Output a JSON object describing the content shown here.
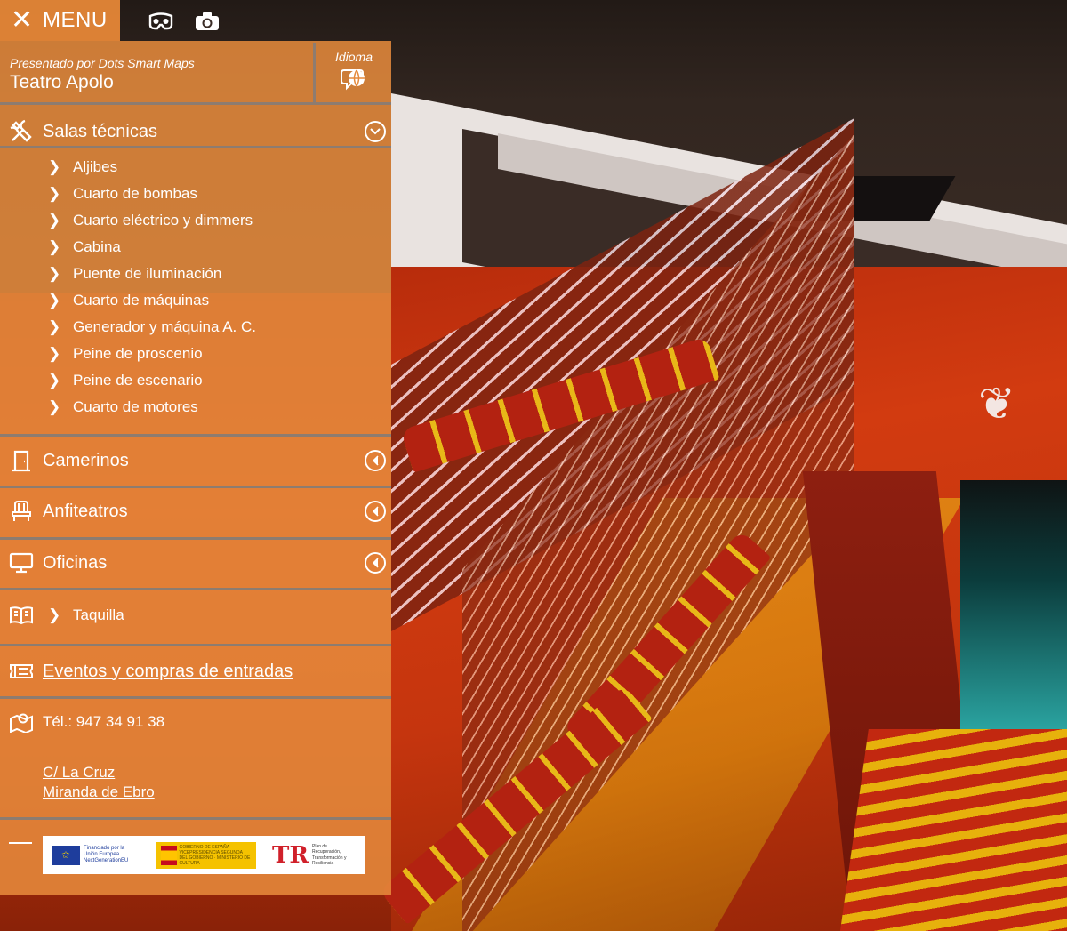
{
  "toolbar": {
    "menu_label": "MENU",
    "icons": [
      "close-icon",
      "vr-headset-icon",
      "camera-icon"
    ]
  },
  "header": {
    "presented_by": "Presentado por Dots Smart Maps",
    "venue": "Teatro Apolo",
    "language_label": "Idioma",
    "language_icon": "globe-chat-icon"
  },
  "sections": {
    "salas": {
      "label": "Salas técnicas",
      "icon": "tools-icon",
      "expanded": true,
      "items": [
        "Aljibes",
        "Cuarto de bombas",
        "Cuarto eléctrico y dimmers",
        "Cabina",
        "Puente de iluminación",
        "Cuarto de máquinas",
        "Generador y máquina A. C.",
        "Peine de proscenio",
        "Peine de escenario",
        "Cuarto de motores"
      ]
    },
    "camerinos": {
      "label": "Camerinos",
      "icon": "door-icon"
    },
    "anfiteatros": {
      "label": "Anfiteatros",
      "icon": "seat-icon"
    },
    "oficinas": {
      "label": "Oficinas",
      "icon": "monitor-icon"
    },
    "taquilla": {
      "label": "Taquilla",
      "icon": "book-icon"
    },
    "eventos": {
      "label": "Eventos y compras de entradas",
      "icon": "ticket-icon"
    },
    "contacto": {
      "phone": "Tél.: 947 34 91 38",
      "address_line1": "C/ La Cruz",
      "address_line2": "Miranda de Ebro",
      "icon": "map-pin-icon"
    }
  },
  "funding": {
    "eu_text": "Financiado por la Unión Europea NextGenerationEU",
    "es_text": "GOBIERNO DE ESPAÑA · VICEPRESIDENCIA SEGUNDA DEL GOBIERNO · MINISTERIO DE CULTURA",
    "tr_text": "Plan de Recuperación, Transformación y Resiliencia"
  }
}
